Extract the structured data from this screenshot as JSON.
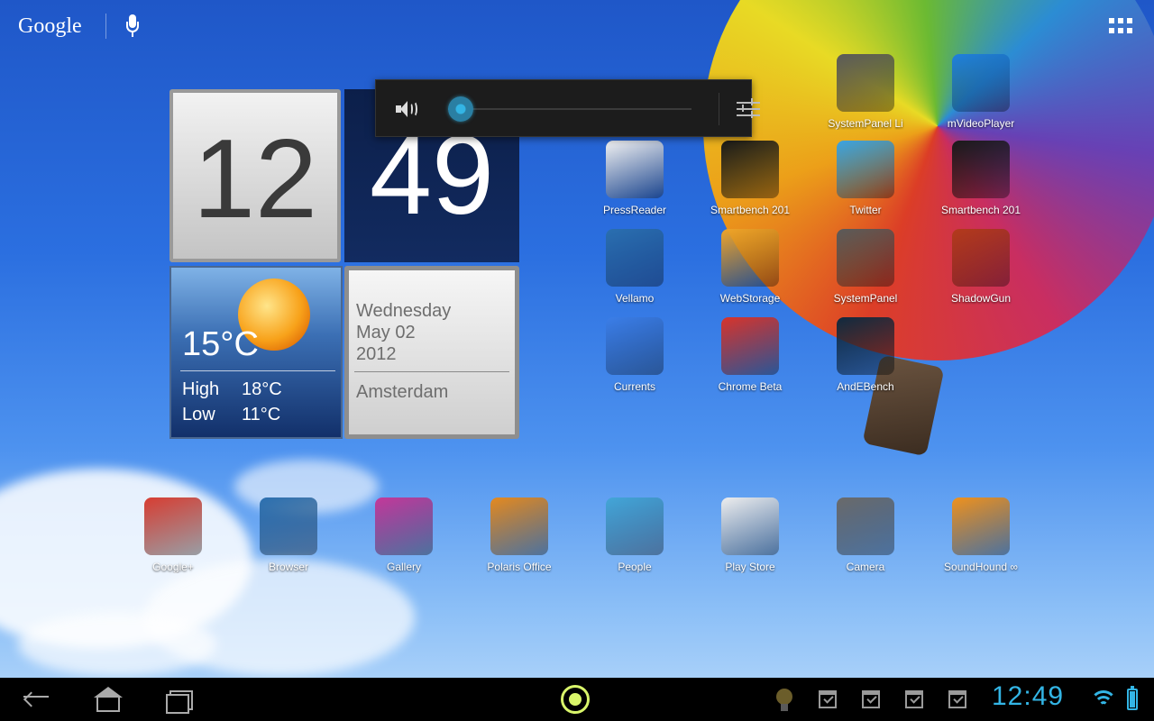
{
  "search": {
    "logo": "Google",
    "mic_icon": "mic-icon"
  },
  "all_apps_icon": "apps-grid-icon",
  "clock": {
    "hours": "12",
    "minutes": "49",
    "temperature": "15°C",
    "high_label": "High",
    "high_value": "18°C",
    "low_label": "Low",
    "low_value": "11°C",
    "day": "Wednesday",
    "month_day": "May 02",
    "year": "2012",
    "city": "Amsterdam",
    "weather_icon": "sun-icon"
  },
  "volume": {
    "level": 0.05,
    "speaker_icon": "speaker-icon",
    "settings_icon": "equalizer-icon"
  },
  "apps": [
    {
      "label": "SystemPanel Li",
      "icon": "systempanel-lite-icon",
      "color": "#5a5a5a"
    },
    {
      "label": "mVideoPlayer",
      "icon": "mvideoplayer-icon",
      "color": "#1e7fe0"
    },
    {
      "label": "PressReader",
      "icon": "pressreader-icon",
      "color": "#f3f3f3"
    },
    {
      "label": "Smartbench 201",
      "icon": "smartbench-2011-icon",
      "color": "#1a1a1a"
    },
    {
      "label": "Twitter",
      "icon": "twitter-icon",
      "color": "#3aa3e3"
    },
    {
      "label": "Smartbench 201",
      "icon": "smartbench-2012-icon",
      "color": "#1a1a1a"
    },
    {
      "label": "Vellamo",
      "icon": "vellamo-icon",
      "color": "#2a6fb0"
    },
    {
      "label": "WebStorage",
      "icon": "webstorage-icon",
      "color": "#f0a529"
    },
    {
      "label": "SystemPanel",
      "icon": "systempanel-icon",
      "color": "#5a5a5a"
    },
    {
      "label": "ShadowGun",
      "icon": "shadowgun-icon",
      "color": "#b33a1c"
    },
    {
      "label": "Currents",
      "icon": "currents-icon",
      "color": "#3b7ee8"
    },
    {
      "label": "Chrome Beta",
      "icon": "chrome-beta-icon",
      "color": "#d9342b"
    },
    {
      "label": "AndEBench",
      "icon": "andebench-icon",
      "color": "#0f2a40"
    }
  ],
  "dock": [
    {
      "label": "Google+",
      "icon": "google-plus-icon",
      "color": "#d73d32"
    },
    {
      "label": "Browser",
      "icon": "browser-globe-icon",
      "color": "#2a6fb0"
    },
    {
      "label": "Gallery",
      "icon": "gallery-icon",
      "color": "#c4389a"
    },
    {
      "label": "Polaris Office",
      "icon": "polaris-office-icon",
      "color": "#e58a1f"
    },
    {
      "label": "People",
      "icon": "people-icon",
      "color": "#43a6d8"
    },
    {
      "label": "Play Store",
      "icon": "play-store-icon",
      "color": "#eeeeee"
    },
    {
      "label": "Camera",
      "icon": "camera-icon",
      "color": "#6a6a6a"
    },
    {
      "label": "SoundHound ∞",
      "icon": "soundhound-icon",
      "color": "#f0921d"
    }
  ],
  "navbar": {
    "back_icon": "back-icon",
    "home_icon": "home-icon",
    "recent_icon": "recent-apps-icon",
    "launcher_icon": "launcher-icon",
    "time": "12:49",
    "accent": "#33b5e5",
    "notification_icons": [
      "lightbulb-icon",
      "download-done-icon",
      "download-done-icon",
      "download-done-icon",
      "download-done-icon"
    ],
    "wifi_icon": "wifi-icon",
    "battery_icon": "battery-icon"
  }
}
